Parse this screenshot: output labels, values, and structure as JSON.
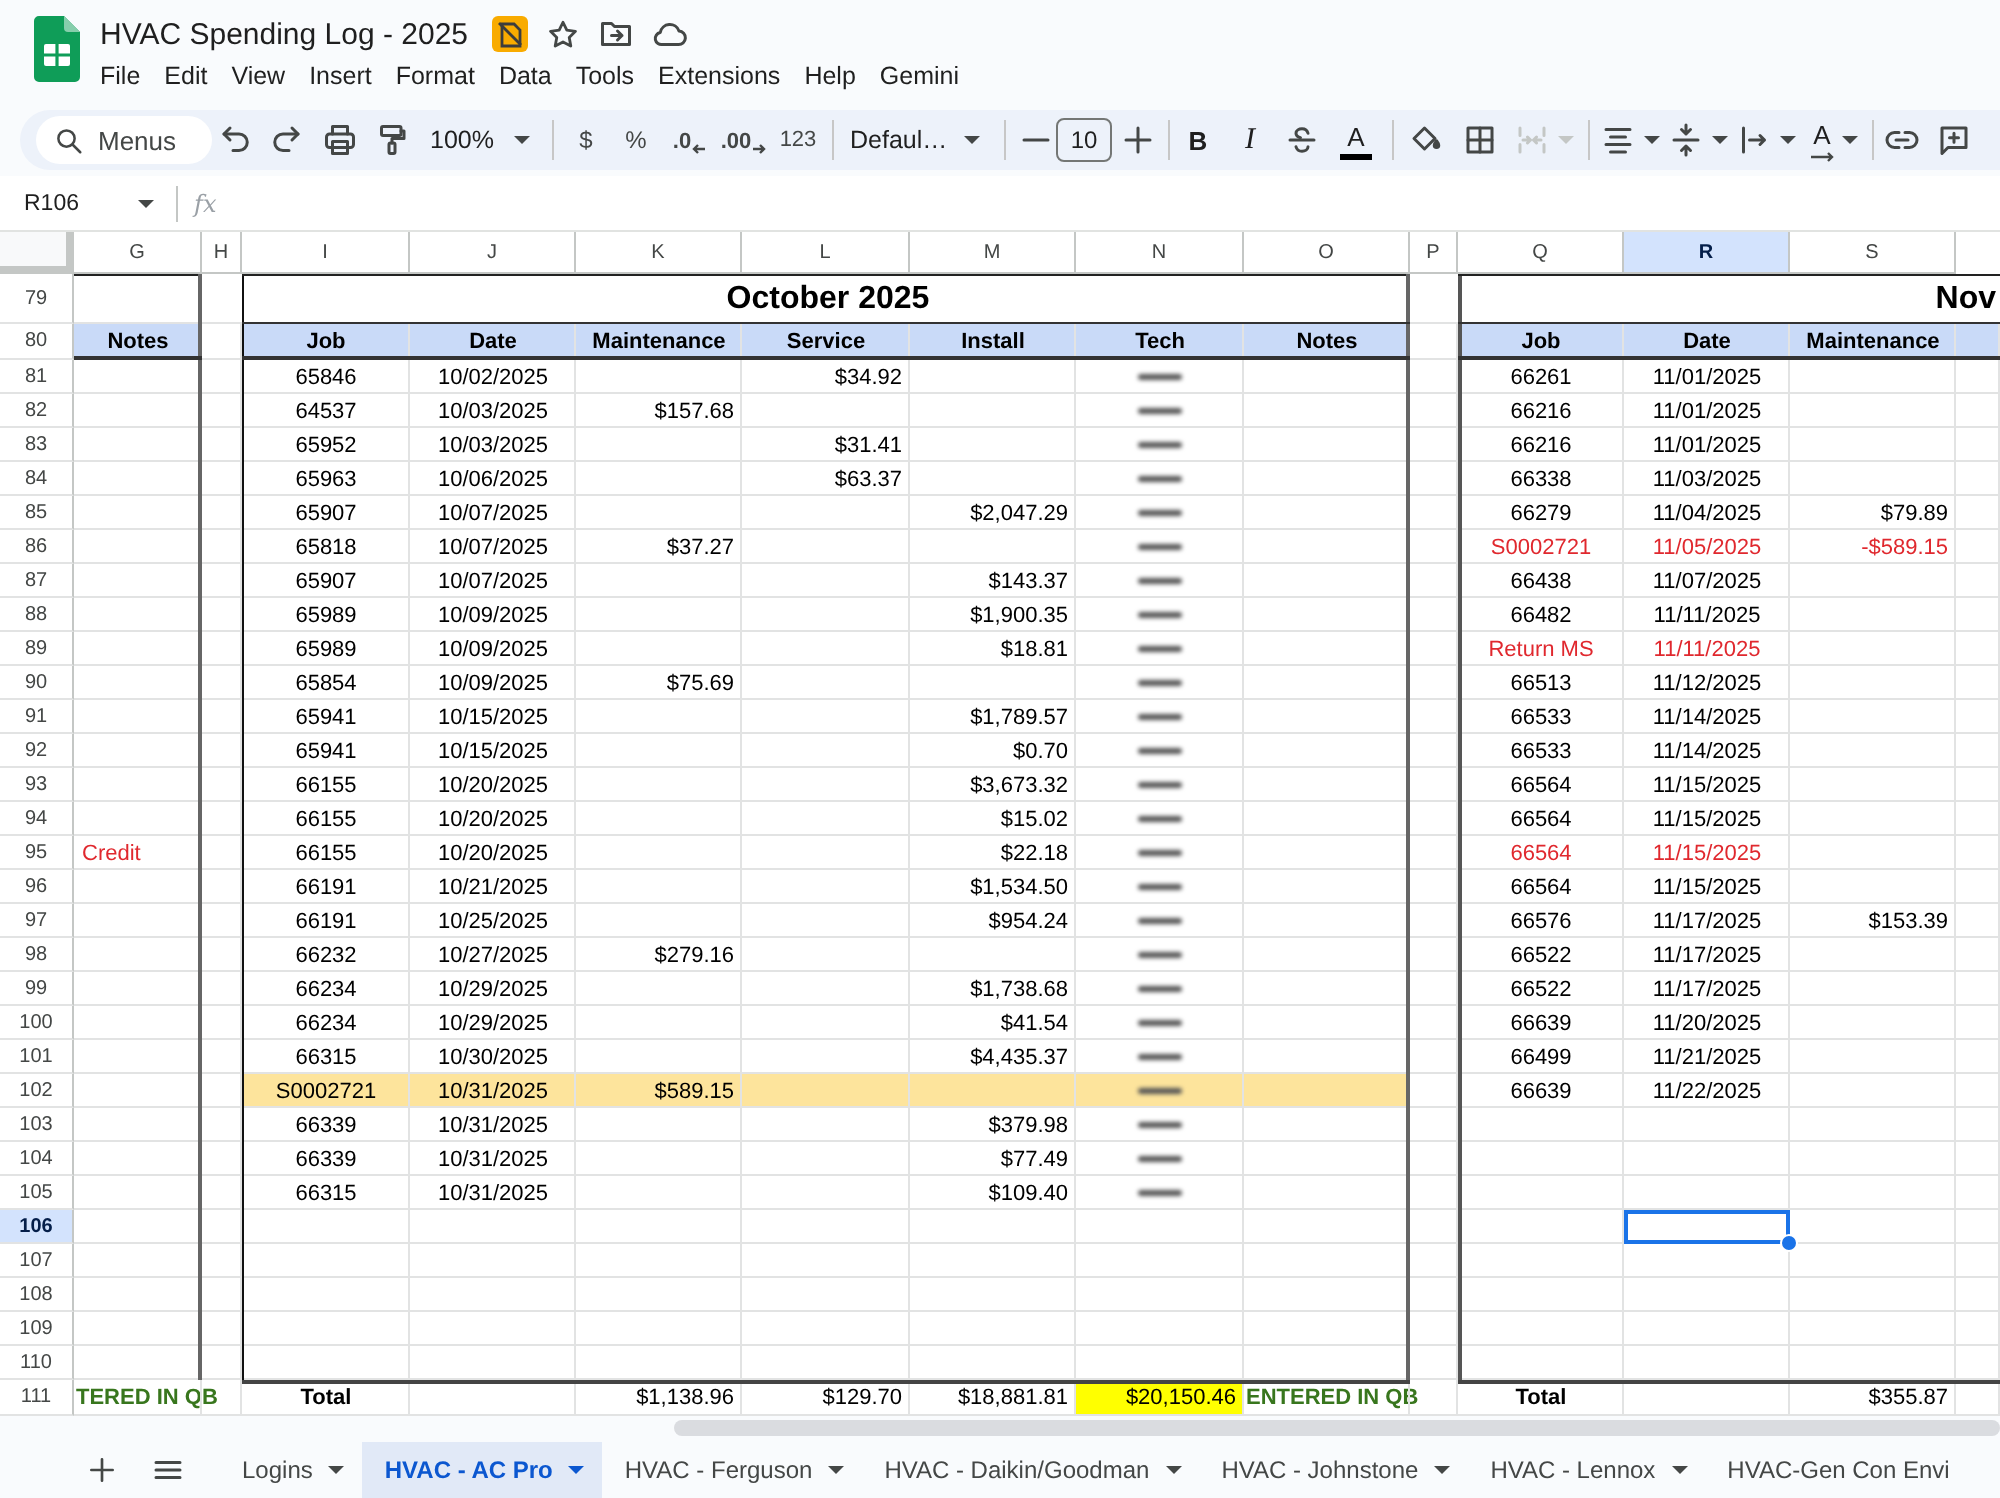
{
  "document": {
    "title": "HVAC Spending Log - 2025",
    "menus": [
      "File",
      "Edit",
      "View",
      "Insert",
      "Format",
      "Data",
      "Tools",
      "Extensions",
      "Help",
      "Gemini"
    ]
  },
  "toolbar": {
    "search": {
      "placeholder": "Menus"
    },
    "zoom": "100%",
    "currency": "$",
    "percent": "%",
    "decrease_decimals": ".0",
    "increase_decimals": ".00",
    "number_format": "123",
    "font": "Defaul…",
    "font_size": "10",
    "bold": "B",
    "italic": "I",
    "text_color": "A",
    "merge_cells": {
      "disabled": true
    },
    "text_rotation": "A"
  },
  "formula_bar": {
    "cell_ref": "R106",
    "function_label": "fx"
  },
  "grid": {
    "columns": [
      {
        "letter": "G",
        "selected": false
      },
      {
        "letter": "H",
        "selected": false
      },
      {
        "letter": "I",
        "selected": false
      },
      {
        "letter": "J",
        "selected": false
      },
      {
        "letter": "K",
        "selected": false
      },
      {
        "letter": "L",
        "selected": false
      },
      {
        "letter": "M",
        "selected": false
      },
      {
        "letter": "N",
        "selected": false
      },
      {
        "letter": "O",
        "selected": false
      },
      {
        "letter": "P",
        "selected": false
      },
      {
        "letter": "Q",
        "selected": false
      },
      {
        "letter": "R",
        "selected": true
      },
      {
        "letter": "S",
        "selected": false
      }
    ],
    "row_numbers": [
      {
        "label": "79",
        "selected": false
      },
      {
        "label": "80",
        "selected": false
      },
      {
        "label": "81",
        "selected": false
      },
      {
        "label": "82",
        "selected": false
      },
      {
        "label": "83",
        "selected": false
      },
      {
        "label": "84",
        "selected": false
      },
      {
        "label": "85",
        "selected": false
      },
      {
        "label": "86",
        "selected": false
      },
      {
        "label": "87",
        "selected": false
      },
      {
        "label": "88",
        "selected": false
      },
      {
        "label": "89",
        "selected": false
      },
      {
        "label": "90",
        "selected": false
      },
      {
        "label": "91",
        "selected": false
      },
      {
        "label": "92",
        "selected": false
      },
      {
        "label": "93",
        "selected": false
      },
      {
        "label": "94",
        "selected": false
      },
      {
        "label": "95",
        "selected": false
      },
      {
        "label": "96",
        "selected": false
      },
      {
        "label": "97",
        "selected": false
      },
      {
        "label": "98",
        "selected": false
      },
      {
        "label": "99",
        "selected": false
      },
      {
        "label": "100",
        "selected": false
      },
      {
        "label": "101",
        "selected": false
      },
      {
        "label": "102",
        "selected": false
      },
      {
        "label": "103",
        "selected": false
      },
      {
        "label": "104",
        "selected": false
      },
      {
        "label": "105",
        "selected": false
      },
      {
        "label": "106",
        "selected": true
      },
      {
        "label": "107",
        "selected": false
      },
      {
        "label": "108",
        "selected": false
      },
      {
        "label": "109",
        "selected": false
      },
      {
        "label": "110",
        "selected": false
      },
      {
        "label": "111",
        "selected": false
      }
    ]
  },
  "notes_column": {
    "header": "Notes"
  },
  "october": {
    "title": "October 2025",
    "headers": [
      "Job",
      "Date",
      "Maintenance",
      "Service",
      "Install",
      "Tech",
      "Notes"
    ],
    "rows": [
      {
        "job": "65846",
        "date": "10/02/2025",
        "service": "$34.92",
        "tech_redacted": true,
        "highlighted": false
      },
      {
        "job": "64537",
        "date": "10/03/2025",
        "maintenance": "$157.68",
        "tech_redacted": true,
        "highlighted": false
      },
      {
        "job": "65952",
        "date": "10/03/2025",
        "service": "$31.41",
        "tech_redacted": true,
        "highlighted": false
      },
      {
        "job": "65963",
        "date": "10/06/2025",
        "service": "$63.37",
        "tech_redacted": true,
        "highlighted": false
      },
      {
        "job": "65907",
        "date": "10/07/2025",
        "install": "$2,047.29",
        "tech_redacted": true,
        "highlighted": false
      },
      {
        "job": "65818",
        "date": "10/07/2025",
        "maintenance": "$37.27",
        "tech_redacted": true,
        "highlighted": false
      },
      {
        "job": "65907",
        "date": "10/07/2025",
        "install": "$143.37",
        "tech_redacted": true,
        "highlighted": false
      },
      {
        "job": "65989",
        "date": "10/09/2025",
        "install": "$1,900.35",
        "tech_redacted": true,
        "highlighted": false
      },
      {
        "job": "65989",
        "date": "10/09/2025",
        "install": "$18.81",
        "tech_redacted": true,
        "highlighted": false
      },
      {
        "job": "65854",
        "date": "10/09/2025",
        "maintenance": "$75.69",
        "tech_redacted": true,
        "highlighted": false
      },
      {
        "job": "65941",
        "date": "10/15/2025",
        "install": "$1,789.57",
        "tech_redacted": true,
        "highlighted": false
      },
      {
        "job": "65941",
        "date": "10/15/2025",
        "install": "$0.70",
        "tech_redacted": true,
        "highlighted": false
      },
      {
        "job": "66155",
        "date": "10/20/2025",
        "install": "$3,673.32",
        "tech_redacted": true,
        "highlighted": false
      },
      {
        "job": "66155",
        "date": "10/20/2025",
        "install": "$15.02",
        "tech_redacted": true,
        "highlighted": false
      },
      {
        "side_note": "Credit",
        "job": "66155",
        "date": "10/20/2025",
        "install": "$22.18",
        "tech_redacted": true,
        "highlighted": false
      },
      {
        "job": "66191",
        "date": "10/21/2025",
        "install": "$1,534.50",
        "tech_redacted": true,
        "highlighted": false
      },
      {
        "job": "66191",
        "date": "10/25/2025",
        "install": "$954.24",
        "tech_redacted": true,
        "highlighted": false
      },
      {
        "job": "66232",
        "date": "10/27/2025",
        "maintenance": "$279.16",
        "tech_redacted": true,
        "highlighted": false
      },
      {
        "job": "66234",
        "date": "10/29/2025",
        "install": "$1,738.68",
        "tech_redacted": true,
        "highlighted": false
      },
      {
        "job": "66234",
        "date": "10/29/2025",
        "install": "$41.54",
        "tech_redacted": true,
        "highlighted": false
      },
      {
        "job": "66315",
        "date": "10/30/2025",
        "install": "$4,435.37",
        "tech_redacted": true,
        "highlighted": false
      },
      {
        "job": "S0002721",
        "date": "10/31/2025",
        "maintenance": "$589.15",
        "tech_redacted": true,
        "highlighted": true
      },
      {
        "job": "66339",
        "date": "10/31/2025",
        "install": "$379.98",
        "tech_redacted": true,
        "highlighted": false
      },
      {
        "job": "66339",
        "date": "10/31/2025",
        "install": "$77.49",
        "tech_redacted": true,
        "highlighted": false
      },
      {
        "job": "66315",
        "date": "10/31/2025",
        "install": "$109.40",
        "tech_redacted": true,
        "highlighted": false
      }
    ],
    "total": {
      "side_note": "TERED IN QB",
      "label": "Total",
      "maintenance": "$1,138.96",
      "service": "$129.70",
      "install": "$18,881.81",
      "tech": "$20,150.46",
      "tech_highlighted": true,
      "notes": "ENTERED IN QB"
    }
  },
  "november": {
    "title": "Nov",
    "headers": [
      "Job",
      "Date",
      "Maintenance"
    ],
    "rows": [
      {
        "job": "66261",
        "date": "11/01/2025",
        "flagged": false
      },
      {
        "job": "66216",
        "date": "11/01/2025",
        "flagged": false
      },
      {
        "job": "66216",
        "date": "11/01/2025",
        "flagged": false
      },
      {
        "job": "66338",
        "date": "11/03/2025",
        "flagged": false
      },
      {
        "job": "66279",
        "date": "11/04/2025",
        "maintenance": "$79.89",
        "flagged": false
      },
      {
        "job": "S0002721",
        "date": "11/05/2025",
        "maintenance": "-$589.15",
        "flagged": true
      },
      {
        "job": "66438",
        "date": "11/07/2025",
        "flagged": false
      },
      {
        "job": "66482",
        "date": "11/11/2025",
        "flagged": false
      },
      {
        "job": "Return MS",
        "date": "11/11/2025",
        "flagged": true
      },
      {
        "job": "66513",
        "date": "11/12/2025",
        "flagged": false
      },
      {
        "job": "66533",
        "date": "11/14/2025",
        "flagged": false
      },
      {
        "job": "66533",
        "date": "11/14/2025",
        "flagged": false
      },
      {
        "job": "66564",
        "date": "11/15/2025",
        "flagged": false
      },
      {
        "job": "66564",
        "date": "11/15/2025",
        "flagged": false
      },
      {
        "job": "66564",
        "date": "11/15/2025",
        "flagged": true
      },
      {
        "job": "66564",
        "date": "11/15/2025",
        "flagged": false
      },
      {
        "job": "66576",
        "date": "11/17/2025",
        "maintenance": "$153.39",
        "flagged": false
      },
      {
        "job": "66522",
        "date": "11/17/2025",
        "flagged": false
      },
      {
        "job": "66522",
        "date": "11/17/2025",
        "flagged": false
      },
      {
        "job": "66639",
        "date": "11/20/2025",
        "flagged": false
      },
      {
        "job": "66499",
        "date": "11/21/2025",
        "flagged": false
      },
      {
        "job": "66639",
        "date": "11/22/2025",
        "flagged": false
      }
    ],
    "total": {
      "label": "Total",
      "maintenance": "$355.87"
    }
  },
  "sheets": [
    {
      "label": "Logins",
      "selected": false
    },
    {
      "label": "HVAC - AC Pro",
      "selected": true
    },
    {
      "label": "HVAC - Ferguson",
      "selected": false
    },
    {
      "label": "HVAC - Daikin/Goodman",
      "selected": false
    },
    {
      "label": "HVAC - Johnstone",
      "selected": false
    },
    {
      "label": "HVAC - Lennox",
      "selected": false
    },
    {
      "label": "HVAC-Gen Con Envi",
      "selected": false
    }
  ]
}
